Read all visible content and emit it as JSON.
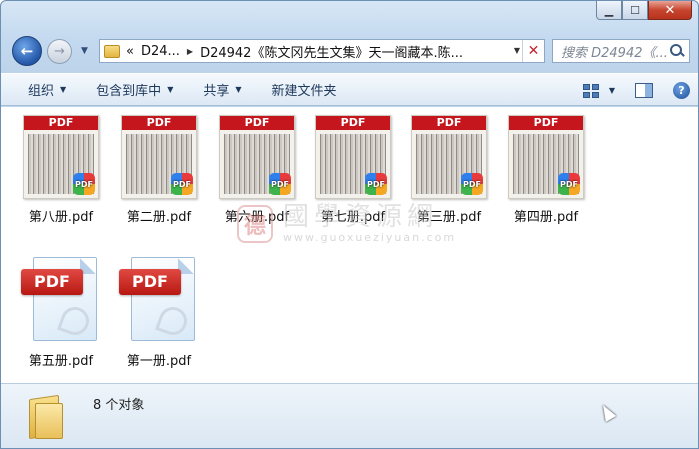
{
  "window": {
    "caption": {
      "minimize": "▁",
      "maximize": "☐",
      "close": "✕"
    }
  },
  "nav": {
    "back_glyph": "←",
    "forward_glyph": "→",
    "recent_glyph": "▼",
    "address": {
      "overflow": "«",
      "crumbs": [
        "D24...",
        "D24942《陈文冈先生文集》天一阁藏本.陈..."
      ],
      "separator": "▶",
      "dropdown": "▼",
      "clear": "✕"
    },
    "search": {
      "placeholder": "搜索 D24942《..."
    }
  },
  "toolbar": {
    "items": [
      {
        "label": "组织",
        "arrow": "▼"
      },
      {
        "label": "包含到库中",
        "arrow": "▼"
      },
      {
        "label": "共享",
        "arrow": "▼"
      },
      {
        "label": "新建文件夹"
      }
    ],
    "view_arrow": "▼",
    "help": "?"
  },
  "files": {
    "thumb_band": "PDF",
    "badge": "PDF",
    "big_label": "PDF",
    "items": [
      {
        "name": "第八册.pdf",
        "kind": "thumb"
      },
      {
        "name": "第二册.pdf",
        "kind": "thumb"
      },
      {
        "name": "第六册.pdf",
        "kind": "thumb"
      },
      {
        "name": "第七册.pdf",
        "kind": "thumb"
      },
      {
        "name": "第三册.pdf",
        "kind": "thumb"
      },
      {
        "name": "第四册.pdf",
        "kind": "thumb"
      },
      {
        "name": "第五册.pdf",
        "kind": "icon"
      },
      {
        "name": "第一册.pdf",
        "kind": "icon"
      }
    ]
  },
  "watermark": {
    "seal": "德",
    "cn": "國學資源網",
    "url": "www.guoxueziyuan.com"
  },
  "status": {
    "count_text": "8 个对象"
  }
}
